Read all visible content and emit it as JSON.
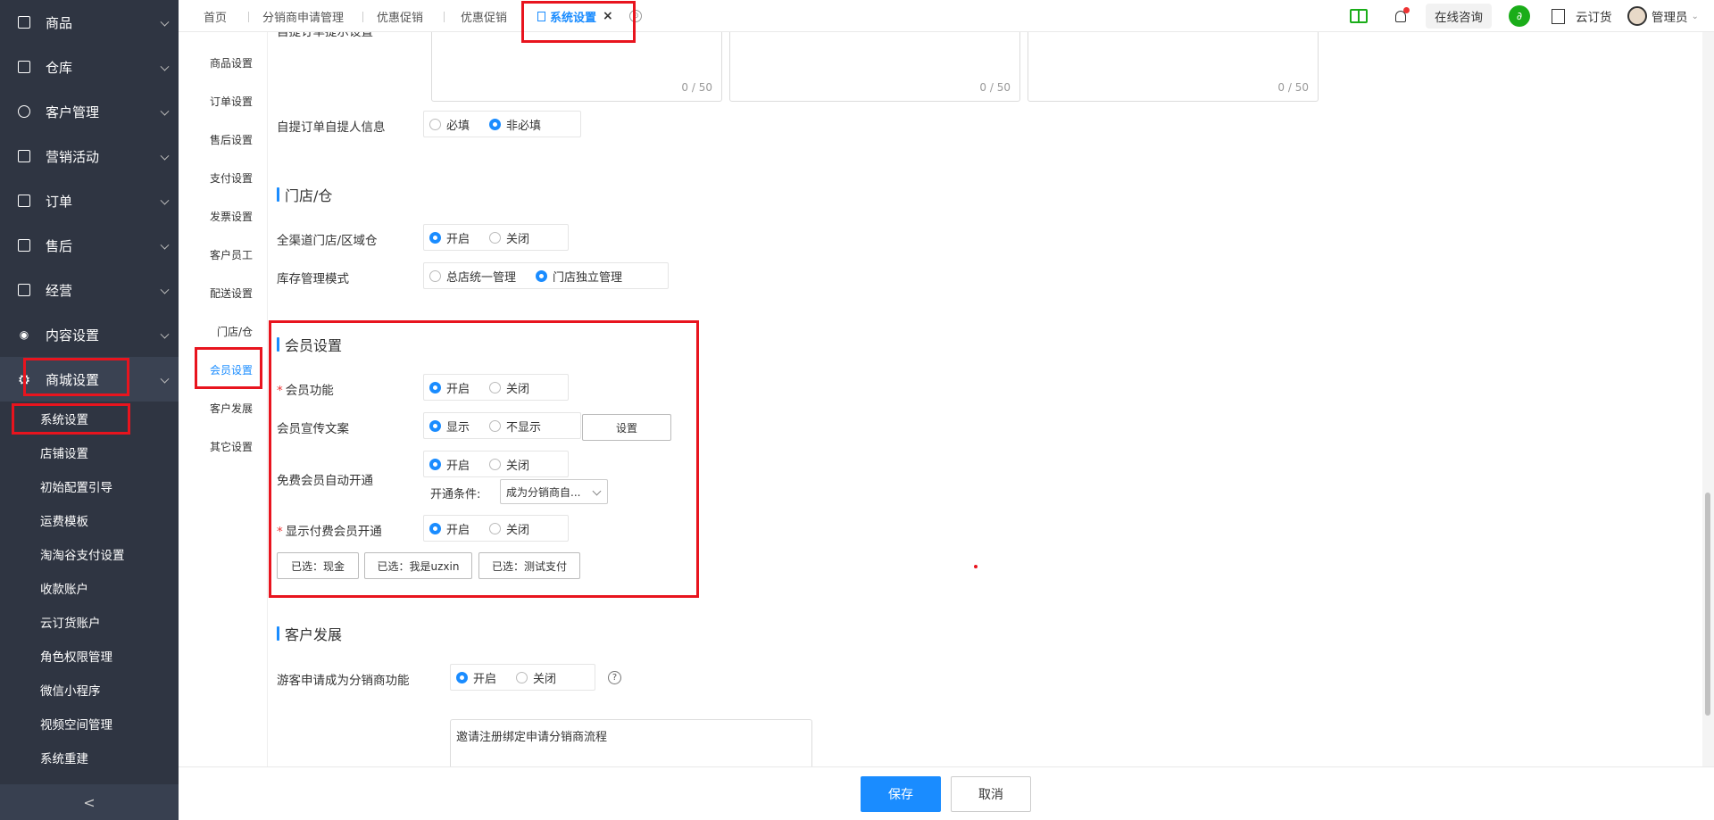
{
  "sidebar": {
    "items": [
      {
        "label": "商品"
      },
      {
        "label": "仓库"
      },
      {
        "label": "客户管理"
      },
      {
        "label": "营销活动"
      },
      {
        "label": "订单"
      },
      {
        "label": "售后"
      },
      {
        "label": "经营"
      },
      {
        "label": "内容设置"
      },
      {
        "label": "商城设置"
      }
    ],
    "subitems": [
      {
        "label": "系统设置"
      },
      {
        "label": "店铺设置"
      },
      {
        "label": "初始配置引导"
      },
      {
        "label": "运费模板"
      },
      {
        "label": "淘淘谷支付设置"
      },
      {
        "label": "收款账户"
      },
      {
        "label": "云订货账户"
      },
      {
        "label": "角色权限管理"
      },
      {
        "label": "微信小程序"
      },
      {
        "label": "视频空间管理"
      },
      {
        "label": "系统重建"
      }
    ],
    "collapse_glyph": "<"
  },
  "tabs": [
    {
      "label": "首页"
    },
    {
      "label": "分销商申请管理"
    },
    {
      "label": "优惠促销"
    },
    {
      "label": "优惠促销"
    },
    {
      "label": "系统设置"
    }
  ],
  "tab_close": "×",
  "header": {
    "consult": "在线咨询",
    "company": "云订货",
    "user": "管理员",
    "mini_glyph": "∂"
  },
  "subnav": [
    {
      "label": "商品设置"
    },
    {
      "label": "订单设置"
    },
    {
      "label": "售后设置"
    },
    {
      "label": "支付设置"
    },
    {
      "label": "发票设置"
    },
    {
      "label": "客户员工"
    },
    {
      "label": "配送设置"
    },
    {
      "label": "门店/仓"
    },
    {
      "label": "会员设置"
    },
    {
      "label": "客户发展"
    },
    {
      "label": "其它设置"
    }
  ],
  "main": {
    "cut_label": "自提订单提示设置",
    "textarea_counter": "0 / 50",
    "pickup_info": {
      "label": "自提订单自提人信息",
      "opt1": "必填",
      "opt2": "非必填"
    },
    "store_section": "门店/仓",
    "allchannel": {
      "label": "全渠道门店/区域仓",
      "opt1": "开启",
      "opt2": "关闭"
    },
    "stock_mode": {
      "label": "库存管理模式",
      "opt1": "总店统一管理",
      "opt2": "门店独立管理"
    },
    "member_section": "会员设置",
    "member_func": {
      "label": "会员功能",
      "opt1": "开启",
      "opt2": "关闭"
    },
    "member_promo": {
      "label": "会员宣传文案",
      "opt1": "显示",
      "opt2": "不显示",
      "button": "设置"
    },
    "free_member": {
      "label": "免费会员自动开通",
      "opt1": "开启",
      "opt2": "关闭",
      "cond_label": "开通条件:",
      "cond_value": "成为分销商自..."
    },
    "paid_member": {
      "label": "显示付费会员开通",
      "opt1": "开启",
      "opt2": "关闭"
    },
    "selected": [
      "已选：现金",
      "已选：我是uzxin",
      "已选：测试支付"
    ],
    "customer_section": "客户发展",
    "visitor_apply": {
      "label": "游客申请成为分销商功能",
      "opt1": "开启",
      "opt2": "关闭"
    },
    "invite_text": "邀请注册绑定申请分销商流程",
    "help_glyph": "?"
  },
  "footer": {
    "save": "保存",
    "cancel": "取消"
  }
}
